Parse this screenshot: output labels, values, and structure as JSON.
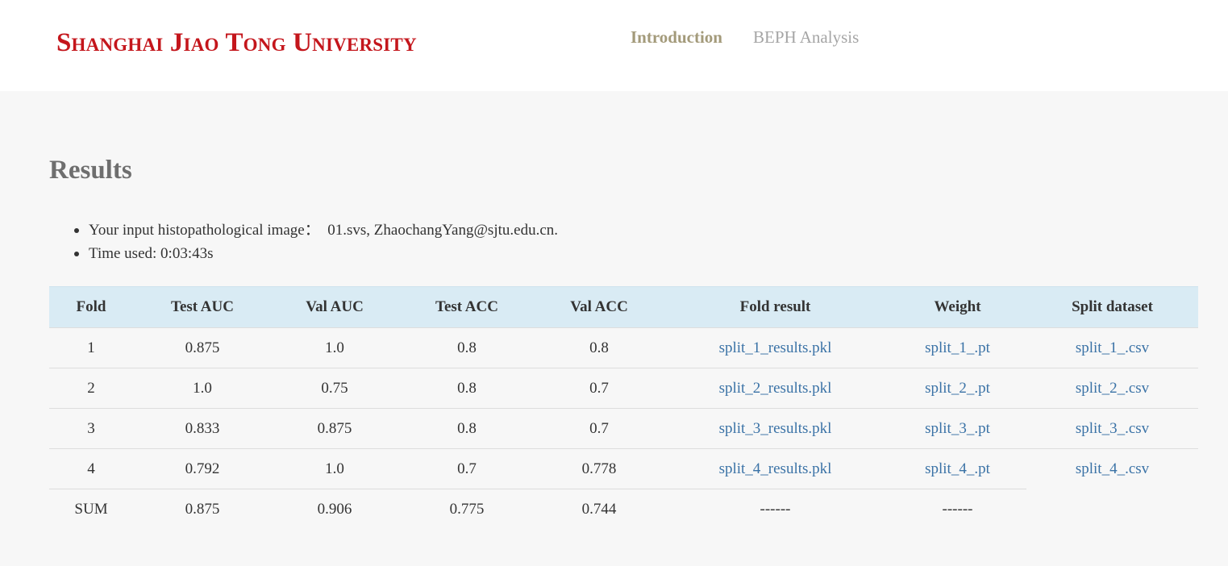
{
  "header": {
    "logo_text": "Shanghai Jiao Tong University",
    "nav": [
      {
        "label": "Introduction",
        "active": true
      },
      {
        "label": "BEPH Analysis",
        "active": false
      }
    ]
  },
  "results": {
    "title": "Results",
    "info": [
      "Your input histopathological image：  01.svs, ZhaochangYang@sjtu.edu.cn.",
      "Time used: 0:03:43s"
    ]
  },
  "table": {
    "headers": [
      "Fold",
      "Test AUC",
      "Val AUC",
      "Test ACC",
      "Val ACC",
      "Fold result",
      "Weight",
      "Split dataset"
    ],
    "rows": [
      {
        "fold": "1",
        "test_auc": "0.875",
        "val_auc": "1.0",
        "test_acc": "0.8",
        "val_acc": "0.8",
        "fold_result": "split_1_results.pkl",
        "weight": "split_1_.pt",
        "split": "split_1_.csv"
      },
      {
        "fold": "2",
        "test_auc": "1.0",
        "val_auc": "0.75",
        "test_acc": "0.8",
        "val_acc": "0.7",
        "fold_result": "split_2_results.pkl",
        "weight": "split_2_.pt",
        "split": "split_2_.csv"
      },
      {
        "fold": "3",
        "test_auc": "0.833",
        "val_auc": "0.875",
        "test_acc": "0.8",
        "val_acc": "0.7",
        "fold_result": "split_3_results.pkl",
        "weight": "split_3_.pt",
        "split": "split_3_.csv"
      },
      {
        "fold": "4",
        "test_auc": "0.792",
        "val_auc": "1.0",
        "test_acc": "0.7",
        "val_acc": "0.778",
        "fold_result": "split_4_results.pkl",
        "weight": "split_4_.pt",
        "split": "split_4_.csv"
      }
    ],
    "sum": {
      "fold": "SUM",
      "test_auc": "0.875",
      "val_auc": "0.906",
      "test_acc": "0.775",
      "val_acc": "0.744",
      "fold_result": "------",
      "weight": "------"
    }
  },
  "colors": {
    "logo": "#c4161c",
    "nav_active": "#a39a7a",
    "nav_inactive": "#a5a5a5",
    "table_header_bg": "#d9ebf4",
    "link": "#3a72a6",
    "page_bg": "#f7f7f7"
  }
}
